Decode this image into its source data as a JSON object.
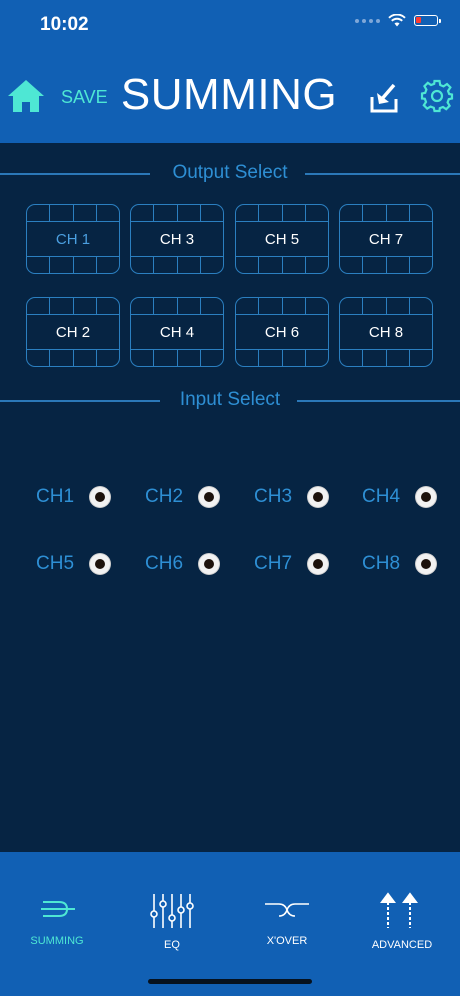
{
  "status_bar": {
    "time": "10:02"
  },
  "header": {
    "save_label": "SAVE",
    "title": "SUMMING"
  },
  "output_select": {
    "title": "Output Select",
    "channels": [
      "CH 1",
      "CH 3",
      "CH 5",
      "CH 7",
      "CH 2",
      "CH 4",
      "CH 6",
      "CH 8"
    ],
    "selected": "CH 1"
  },
  "input_select": {
    "title": "Input Select",
    "channels": [
      "CH1",
      "CH2",
      "CH3",
      "CH4",
      "CH5",
      "CH6",
      "CH7",
      "CH8"
    ]
  },
  "tabs": [
    {
      "label": "SUMMING",
      "icon": "summing-icon",
      "active": true
    },
    {
      "label": "EQ",
      "icon": "eq-sliders-icon",
      "active": false
    },
    {
      "label": "X'OVER",
      "icon": "crossover-icon",
      "active": false
    },
    {
      "label": "ADVANCED",
      "icon": "advanced-arrows-icon",
      "active": false
    }
  ],
  "colors": {
    "header": "#1160b4",
    "background": "#062443",
    "accent": "#4ee7d4",
    "section": "#2e8fd4"
  }
}
